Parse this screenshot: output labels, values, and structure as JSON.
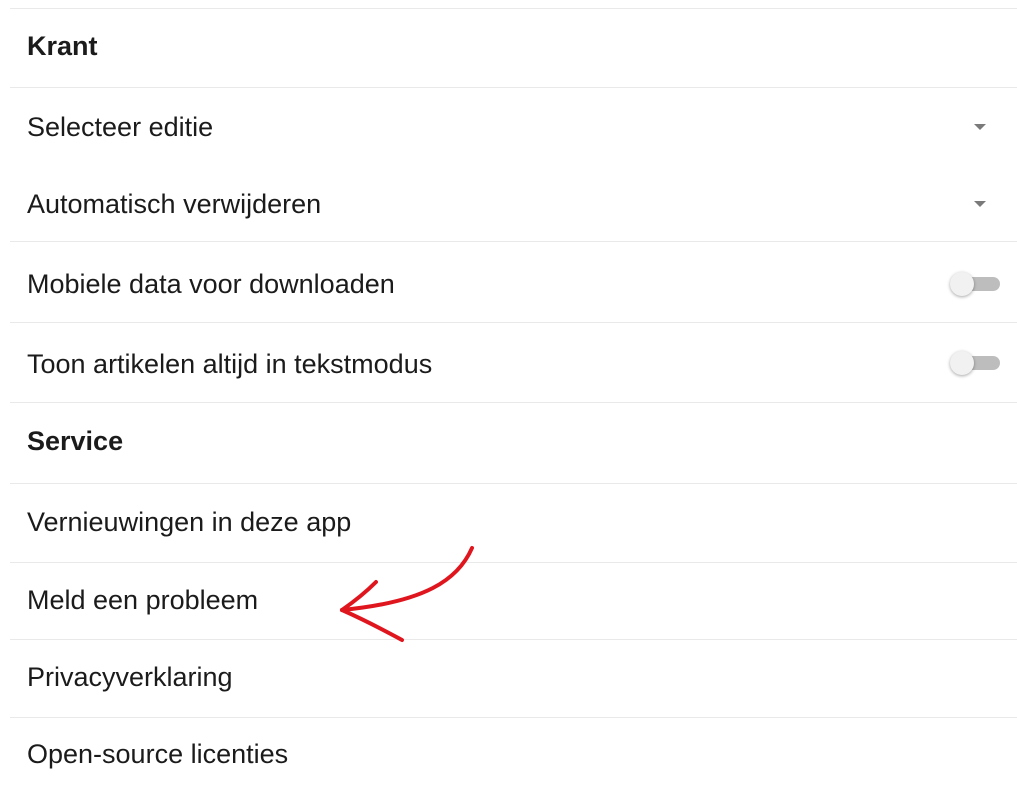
{
  "krant": {
    "header": "Krant",
    "items": [
      {
        "label": "Selecteer editie",
        "control": "dropdown"
      },
      {
        "label": "Automatisch verwijderen",
        "control": "dropdown"
      },
      {
        "label": "Mobiele data voor downloaden",
        "control": "toggle",
        "value": false
      },
      {
        "label": "Toon artikelen altijd in tekstmodus",
        "control": "toggle",
        "value": false
      }
    ]
  },
  "service": {
    "header": "Service",
    "items": [
      {
        "label": "Vernieuwingen in deze app"
      },
      {
        "label": "Meld een probleem"
      },
      {
        "label": "Privacyverklaring"
      },
      {
        "label": "Open-source licenties"
      }
    ]
  },
  "annotation": {
    "type": "arrow",
    "color": "#e0161f",
    "points_to": "Meld een probleem"
  },
  "icons": {
    "dropdown": "caret-down-icon",
    "toggle": "switch-off"
  }
}
